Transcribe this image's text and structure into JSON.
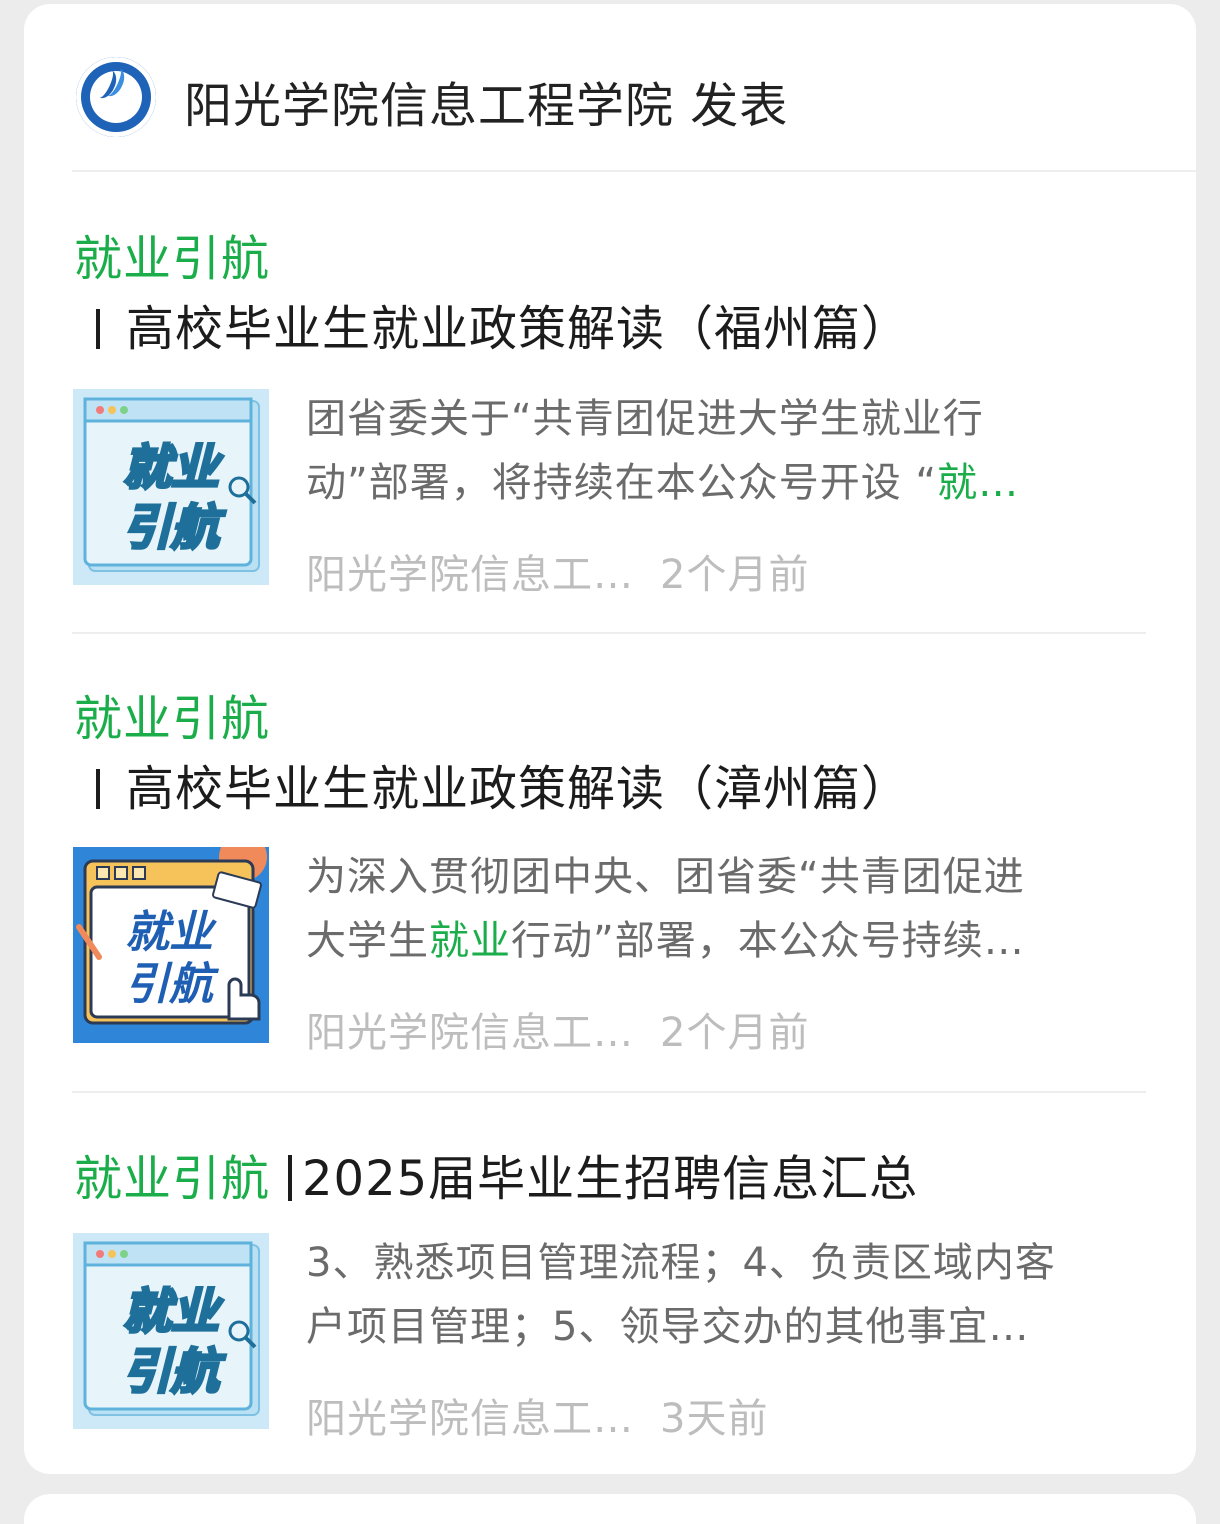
{
  "account": {
    "name_line": "阳光学院信息工程学院 发表"
  },
  "articles": [
    {
      "tag": "就业引航",
      "title": "高校毕业生就业政策解读（福州篇）",
      "summary_line1": "团省委关于“共青团促进大学生就业行",
      "summary_line2_prefix": "动”部署，将持续在本公众号开设 “",
      "summary_line2_highlight": "就…",
      "source": "阳光学院信息工…",
      "time": "2个月前",
      "thumb_text1": "就业",
      "thumb_text2": "引航"
    },
    {
      "tag": "就业引航",
      "title": "高校毕业生就业政策解读（漳州篇）",
      "summary_line1": "为深入贯彻团中央、团省委“共青团促进",
      "summary_line2_prefix": "大学生",
      "summary_line2_highlight": "就业",
      "summary_line2_suffix": "行动”部署，本公众号持续…",
      "source": "阳光学院信息工…",
      "time": "2个月前",
      "thumb_text1": "就业",
      "thumb_text2": "引航"
    },
    {
      "tag": "就业引航",
      "title": "2025届毕业生招聘信息汇总",
      "summary_line1": "3、熟悉项目管理流程；4、负责区域内客",
      "summary_line2_prefix": "户项目管理；5、领导交办的其他事宜…",
      "source": "阳光学院信息工…",
      "time": "3天前",
      "thumb_text1": "就业",
      "thumb_text2": "引航"
    }
  ],
  "colors": {
    "accent": "#1aad4a",
    "title": "#1c1c1c",
    "summary": "#6b6b6b",
    "meta": "#bdbdbd"
  }
}
